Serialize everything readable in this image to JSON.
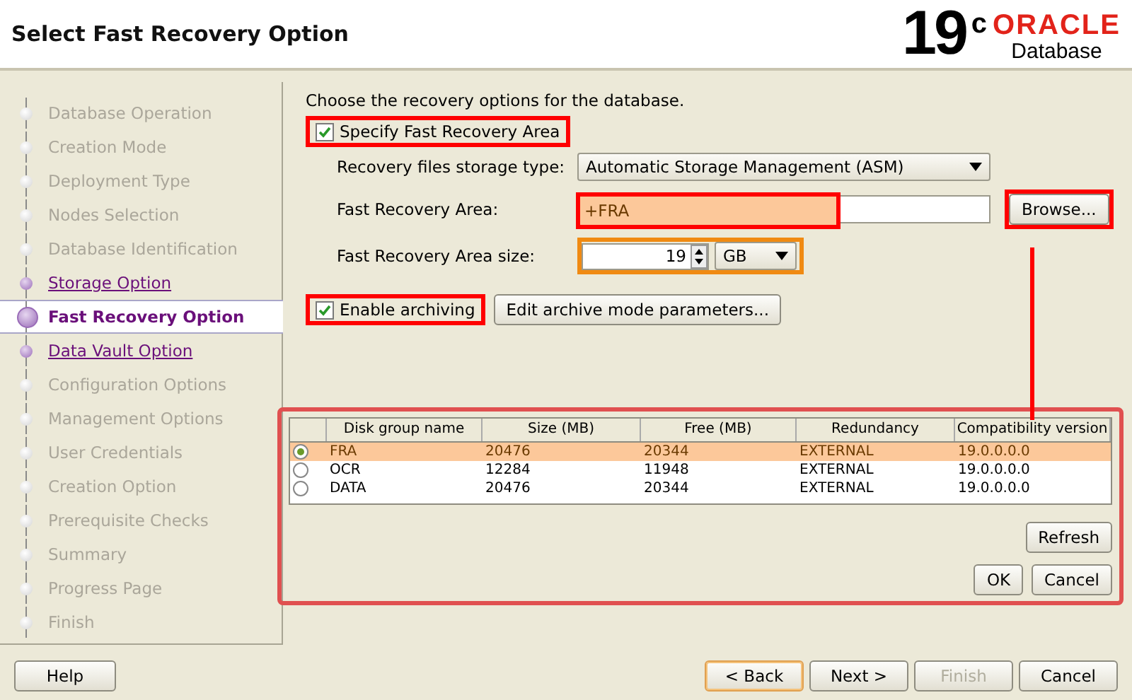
{
  "window": {
    "title": "Select Fast Recovery Option"
  },
  "logo": {
    "version": "19",
    "superscript": "c",
    "brand": "ORACLE",
    "product": "Database"
  },
  "steps": [
    {
      "label": "Database Operation",
      "selected": false,
      "disabled": true
    },
    {
      "label": "Creation Mode",
      "selected": false,
      "disabled": true
    },
    {
      "label": "Deployment Type",
      "selected": false,
      "disabled": true
    },
    {
      "label": "Nodes Selection",
      "selected": false,
      "disabled": true
    },
    {
      "label": "Database Identification",
      "selected": false,
      "disabled": true
    },
    {
      "label": "Storage Option",
      "selected": false,
      "disabled": false
    },
    {
      "label": "Fast Recovery Option",
      "selected": true,
      "disabled": false
    },
    {
      "label": "Data Vault Option",
      "selected": false,
      "disabled": false
    },
    {
      "label": "Configuration Options",
      "selected": false,
      "disabled": true
    },
    {
      "label": "Management Options",
      "selected": false,
      "disabled": true
    },
    {
      "label": "User Credentials",
      "selected": false,
      "disabled": true
    },
    {
      "label": "Creation Option",
      "selected": false,
      "disabled": true
    },
    {
      "label": "Prerequisite Checks",
      "selected": false,
      "disabled": true
    },
    {
      "label": "Summary",
      "selected": false,
      "disabled": true
    },
    {
      "label": "Progress Page",
      "selected": false,
      "disabled": true
    },
    {
      "label": "Finish",
      "selected": false,
      "disabled": true
    }
  ],
  "intro": "Choose the recovery options for the database.",
  "specify_fra": {
    "label": "Specify Fast Recovery Area",
    "checked": true
  },
  "storage_type": {
    "label": "Recovery files storage type:",
    "value": "Automatic Storage Management (ASM)"
  },
  "fra_location": {
    "label": "Fast Recovery Area:",
    "value": "+FRA",
    "browse": "Browse..."
  },
  "fra_size": {
    "label": "Fast Recovery Area size:",
    "value": "19",
    "unit": "GB"
  },
  "archiving": {
    "label": "Enable archiving",
    "checked": true,
    "button": "Edit archive mode parameters..."
  },
  "disk_groups": {
    "columns": [
      "Disk group name",
      "Size (MB)",
      "Free (MB)",
      "Redundancy",
      "Compatibility version"
    ],
    "rows": [
      {
        "selected": true,
        "cells": [
          "FRA",
          "20476",
          "20344",
          "EXTERNAL",
          "19.0.0.0.0"
        ]
      },
      {
        "selected": false,
        "cells": [
          "OCR",
          "12284",
          "11948",
          "EXTERNAL",
          "19.0.0.0.0"
        ]
      },
      {
        "selected": false,
        "cells": [
          "DATA",
          "20476",
          "20344",
          "EXTERNAL",
          "19.0.0.0.0"
        ]
      }
    ],
    "refresh": "Refresh",
    "ok": "OK",
    "cancel": "Cancel"
  },
  "footer": {
    "help": "Help",
    "buttons": [
      {
        "label": "< Back",
        "disabled": false,
        "default": true
      },
      {
        "label": "Next >",
        "disabled": false,
        "default": false
      },
      {
        "label": "Finish",
        "disabled": true,
        "default": false
      },
      {
        "label": "Cancel",
        "disabled": false,
        "default": false
      }
    ]
  }
}
